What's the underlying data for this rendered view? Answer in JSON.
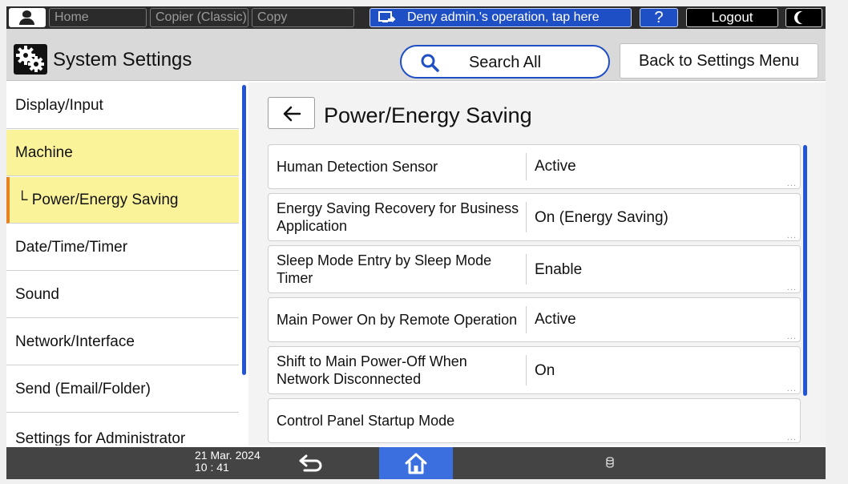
{
  "topbar": {
    "home_label": "Home",
    "copier_classic_label": "Copier (Classic)",
    "copy_label": "Copy",
    "deny_label": "Deny admin.'s operation, tap here",
    "help_label": "?",
    "logout_label": "Logout",
    "user_icon": "user-icon",
    "moon_icon": "moon-icon"
  },
  "header": {
    "title": "System Settings",
    "search_label": "Search All",
    "back_label": "Back to Settings Menu"
  },
  "sidebar": {
    "items": [
      {
        "label": "Display/Input"
      },
      {
        "label": "Machine"
      },
      {
        "label": "└ Power/Energy Saving"
      },
      {
        "label": "Date/Time/Timer"
      },
      {
        "label": "Sound"
      },
      {
        "label": "Network/Interface"
      },
      {
        "label": "Send (Email/Folder)"
      },
      {
        "label": "Settings for Administrator"
      }
    ]
  },
  "main": {
    "title": "Power/Energy Saving",
    "rows": [
      {
        "label_lines": [
          "Human Detection Sensor"
        ],
        "value": "Active"
      },
      {
        "label_lines": [
          "Energy Saving Recovery for Business",
          "Application"
        ],
        "value": "On (Energy Saving)"
      },
      {
        "label_lines": [
          "Sleep Mode Entry by Sleep Mode",
          "Timer"
        ],
        "value": "Enable"
      },
      {
        "label_lines": [
          "Main Power On by Remote Operation"
        ],
        "value": "Active"
      },
      {
        "label_lines": [
          "Shift to Main Power-Off When",
          "Network Disconnected"
        ],
        "value": "On"
      },
      {
        "label_lines": [
          "Control Panel Startup Mode"
        ],
        "value": ""
      }
    ],
    "dots": "..."
  },
  "bottombar": {
    "date": "21 Mar. 2024",
    "time": "10 : 41"
  },
  "colors": {
    "accent_blue": "#1f4fc4",
    "highlight_yellow": "#fbf39a",
    "active_marker": "#e8821e",
    "scrollbar_blue": "#2454d6"
  }
}
